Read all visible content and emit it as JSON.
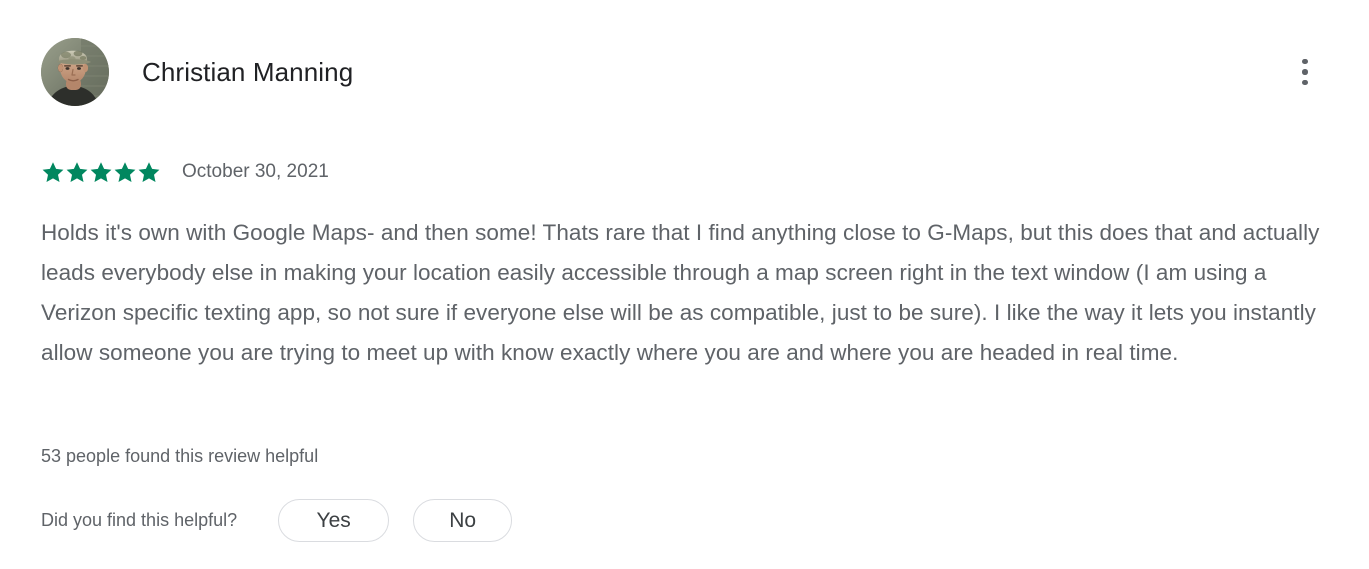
{
  "review": {
    "reviewer_name": "Christian Manning",
    "avatar_alt": "user-avatar-photo",
    "overflow_menu_label": "more-options",
    "rating": 5,
    "max_rating": 5,
    "star_glyph": "★",
    "date": "October 30, 2021",
    "text": "Holds it's own with Google Maps- and then some! Thats rare that I find anything close to G-Maps, but this does that and actually leads everybody else in making your location easily accessible through a map screen right in the text window (I am using a Verizon specific texting app, so not sure if everyone else will be as compatible, just to be sure). I like the way it lets you instantly allow someone you are trying to meet up with know exactly where you are and where you are headed in real time.",
    "helpful_count_text": "53 people found this review helpful",
    "helpful_count": 53,
    "feedback_prompt": "Did you find this helpful?",
    "yes_label": "Yes",
    "no_label": "No"
  },
  "colors": {
    "star_green": "#01875f",
    "name_text": "#202124",
    "body_text": "#5f6368",
    "button_border": "#dadce0",
    "button_text": "#3c4043",
    "background": "#ffffff"
  }
}
